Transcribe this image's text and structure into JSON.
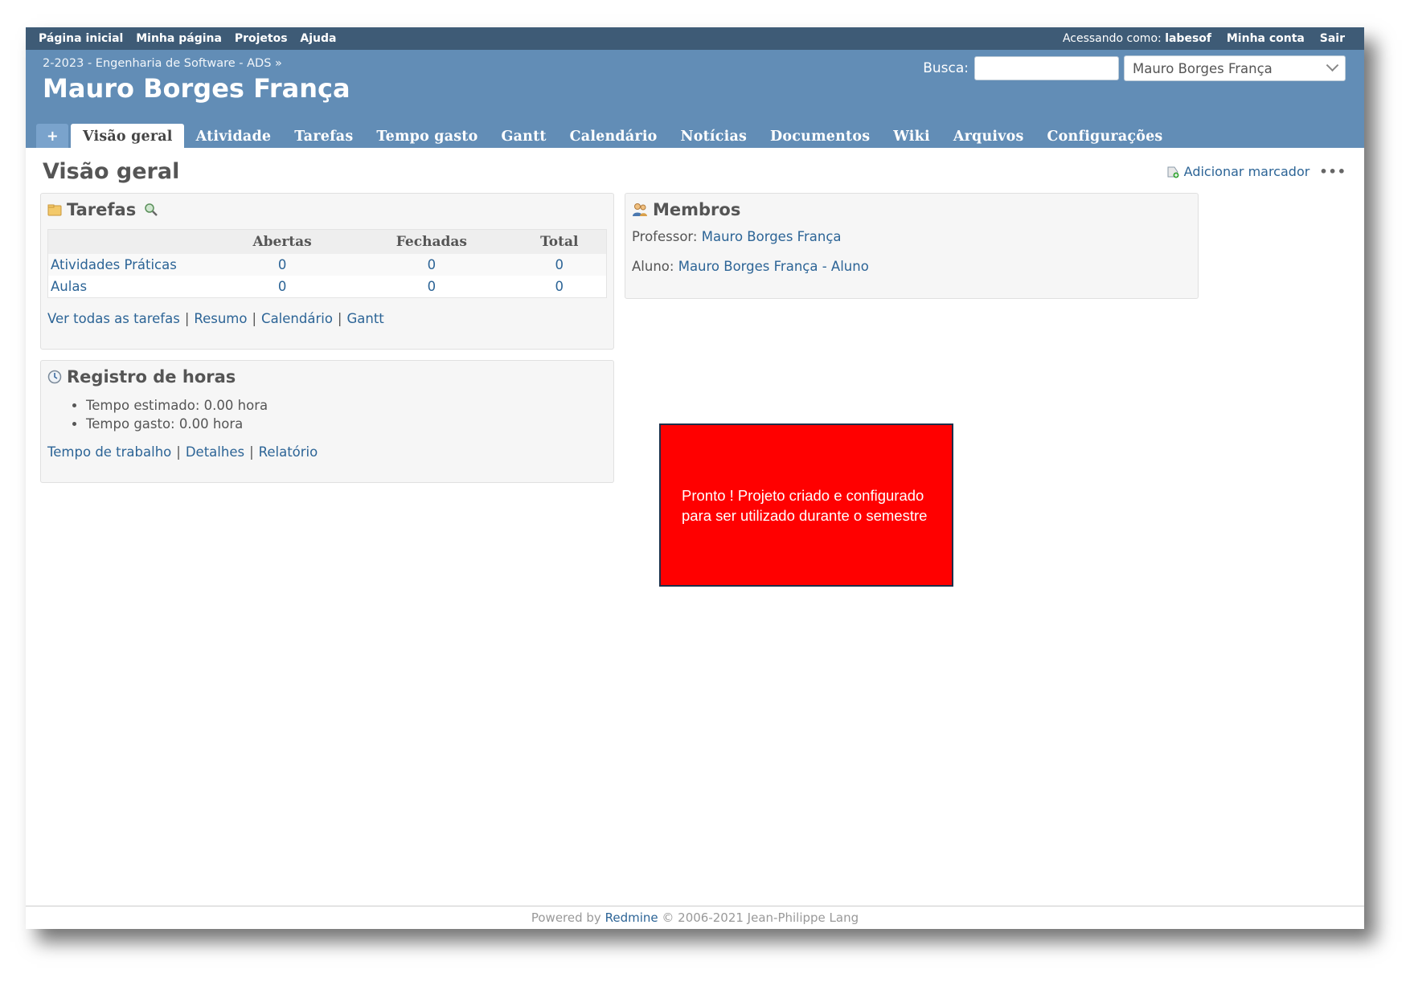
{
  "top_menu": {
    "links": [
      "Página inicial",
      "Minha página",
      "Projetos",
      "Ajuda"
    ],
    "logged_as_label": "Acessando como:",
    "logged_user": "labesof",
    "my_account": "Minha conta",
    "sign_out": "Sair"
  },
  "header": {
    "breadcrumb": "2-2023 - Engenharia de Software - ADS »",
    "title": "Mauro Borges França",
    "search_label": "Busca:",
    "search_value": "",
    "project_select": "Mauro Borges França"
  },
  "tabs": {
    "plus": "+",
    "items": [
      "Visão geral",
      "Atividade",
      "Tarefas",
      "Tempo gasto",
      "Gantt",
      "Calendário",
      "Notícias",
      "Documentos",
      "Wiki",
      "Arquivos",
      "Configurações"
    ],
    "selected": "Visão geral"
  },
  "page": {
    "heading": "Visão geral",
    "add_bookmark": "Adicionar marcador",
    "more": "•••"
  },
  "issues_box": {
    "title": "Tarefas",
    "columns": [
      "",
      "Abertas",
      "Fechadas",
      "Total"
    ],
    "rows": [
      {
        "tracker": "Atividades Práticas",
        "open": "0",
        "closed": "0",
        "total": "0"
      },
      {
        "tracker": "Aulas",
        "open": "0",
        "closed": "0",
        "total": "0"
      }
    ],
    "links": [
      "Ver todas as tarefas",
      "Resumo",
      "Calendário",
      "Gantt"
    ],
    "separator": "|"
  },
  "time_box": {
    "title": "Registro de horas",
    "items": [
      "Tempo estimado: 0.00 hora",
      "Tempo gasto: 0.00 hora"
    ],
    "links": [
      "Tempo de trabalho",
      "Detalhes",
      "Relatório"
    ],
    "separator": "|"
  },
  "members_box": {
    "title": "Membros",
    "groups": [
      {
        "role": "Professor:",
        "member": "Mauro Borges França"
      },
      {
        "role": "Aluno:",
        "member": "Mauro Borges França - Aluno"
      }
    ]
  },
  "callout": {
    "text": "Pronto ! Projeto criado e configurado para ser utilizado durante o semestre"
  },
  "footer": {
    "powered_by": "Powered by",
    "redmine": "Redmine",
    "copyright": "© 2006-2021 Jean-Philippe Lang"
  },
  "colors": {
    "top_menu_bg": "#3e5b76",
    "header_bg": "#628db6",
    "link": "#2c6496",
    "callout_bg": "#ff0000"
  }
}
